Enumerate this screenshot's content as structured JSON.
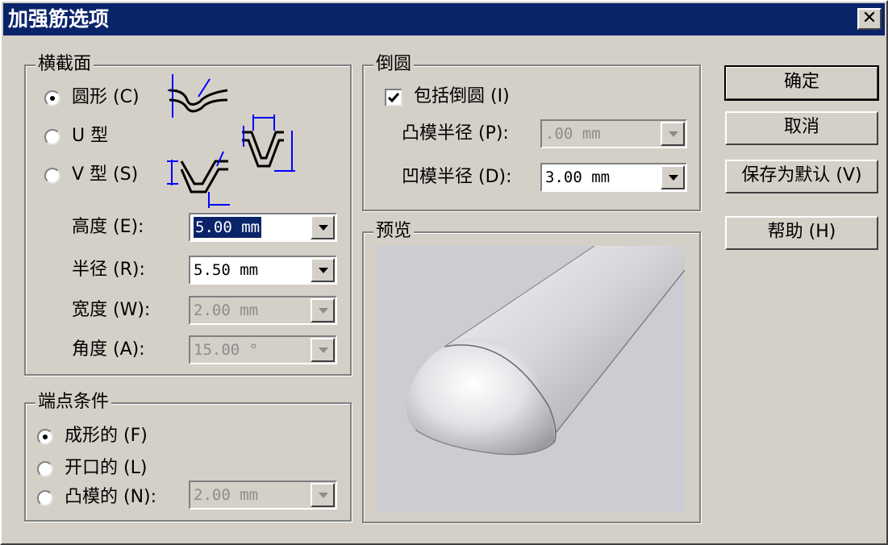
{
  "window": {
    "title": "加强筋选项",
    "close_label": "✕"
  },
  "cross_section": {
    "legend": "横截面",
    "options": [
      {
        "label": "圆形 (C)",
        "selected": true
      },
      {
        "label": "U 型",
        "selected": false
      },
      {
        "label": "V 型 (S)",
        "selected": false
      }
    ],
    "fields": [
      {
        "label": "高度 (E):",
        "value": "5.00 mm",
        "enabled": true,
        "selected_text": true
      },
      {
        "label": "半径 (R):",
        "value": "5.50 mm",
        "enabled": true,
        "selected_text": false
      },
      {
        "label": "宽度 (W):",
        "value": "2.00 mm",
        "enabled": false,
        "selected_text": false
      },
      {
        "label": "角度 (A):",
        "value": "15.00 °",
        "enabled": false,
        "selected_text": false
      }
    ]
  },
  "end_condition": {
    "legend": "端点条件",
    "options": [
      {
        "label": "成形的 (F)",
        "selected": true
      },
      {
        "label": "开口的 (L)",
        "selected": false
      },
      {
        "label": "凸模的 (N):",
        "selected": false
      }
    ],
    "punch_value": "2.00 mm"
  },
  "fillet": {
    "legend": "倒圆",
    "include_label": "包括倒圆 (I)",
    "include_checked": true,
    "punch_radius_label": "凸模半径 (P):",
    "punch_radius_value": ".00 mm",
    "die_radius_label": "凹模半径 (D):",
    "die_radius_value": "3.00 mm"
  },
  "preview": {
    "legend": "预览"
  },
  "buttons": {
    "ok": "确定",
    "cancel": "取消",
    "save_default": "保存为默认 (V)",
    "help": "帮助 (H)"
  },
  "colors": {
    "title_bar": "#0a246a",
    "dialog_bg": "#d4d0c8",
    "dimension_blue": "#0000ff"
  }
}
